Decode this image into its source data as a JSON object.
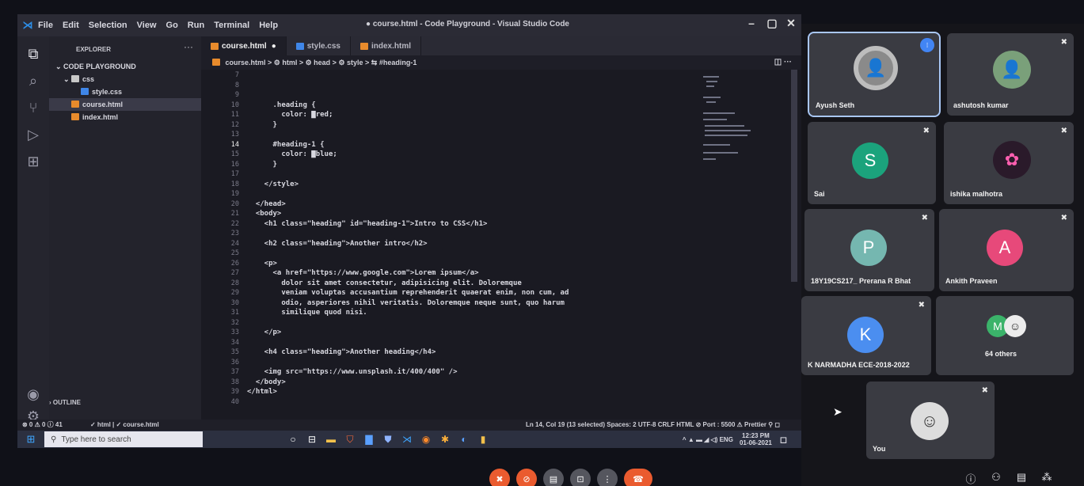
{
  "window": {
    "title": "● course.html - Code Playground - Visual Studio Code",
    "menu": [
      "File",
      "Edit",
      "Selection",
      "View",
      "Go",
      "Run",
      "Terminal",
      "Help"
    ],
    "controls": [
      "–",
      "▢",
      "✕"
    ]
  },
  "sidebar": {
    "header": "EXPLORER",
    "more": "···",
    "workspace": "CODE PLAYGROUND",
    "folder": "css",
    "files": [
      "style.css",
      "course.html",
      "index.html"
    ],
    "outline": "OUTLINE"
  },
  "tabs": [
    {
      "label": "course.html",
      "marker": "●",
      "type": "html"
    },
    {
      "label": "style.css",
      "marker": "",
      "type": "css"
    },
    {
      "label": "index.html",
      "marker": "",
      "type": "html"
    }
  ],
  "breadcrumb": "course.html > ⚙ html > ⚙ head > ⚙ style > ⇆ #heading-1",
  "breadcrumb_icons": "◫ ···",
  "editor": {
    "line_numbers": [
      "7",
      "8",
      "9",
      "10",
      "11",
      "12",
      "13",
      "14",
      "15",
      "16",
      "17",
      "18",
      "19",
      "20",
      "21",
      "22",
      "23",
      "24",
      "25",
      "26",
      "27",
      "28",
      "29",
      "30",
      "31",
      "32",
      "33",
      "34",
      "35",
      "36",
      "37",
      "38",
      "39",
      "40"
    ],
    "current_line": "14",
    "code": [
      "",
      "",
      "",
      "      .heading {",
      "        color: ▇red;",
      "      }",
      "",
      "      #heading-1 {",
      "        color: ▇blue;",
      "      }",
      "",
      "    </style>",
      "",
      "  </head>",
      "  <body>",
      "    <h1 class=\"heading\" id=\"heading-1\">Intro to CSS</h1>",
      "",
      "    <h2 class=\"heading\">Another intro</h2>",
      "",
      "    <p>",
      "      <a href=\"https://www.google.com\">Lorem ipsum</a>",
      "        dolor sit amet consectetur, adipisicing elit. Doloremque",
      "        veniam voluptas accusantium reprehenderit quaerat enim, non cum, ad",
      "        odio, asperiores nihil veritatis. Doloremque neque sunt, quo harum",
      "        similique quod nisi.",
      "",
      "    </p>",
      "",
      "    <h4 class=\"heading\">Another heading</h4>",
      "",
      "    <img src=\"https://www.unsplash.it/400/400\" />",
      "  </body>",
      "</html>",
      ""
    ]
  },
  "status": {
    "problems": "⊗ 0 ⚠ 0 ⓘ 41",
    "context": "✓ html | ✓ course.html",
    "right": "Ln 14, Col 19 (13 selected)   Spaces: 2   UTF-8   CRLF   HTML   ⊘ Port : 5500   ⚠ Prettier   ⚲   ◻"
  },
  "taskbar": {
    "search_placeholder": "Type here to search",
    "tray": "^ ▲ ▬ ◢ ◁) ENG",
    "time": "12:23 PM",
    "date": "01-06-2021"
  },
  "meet": {
    "participants": [
      {
        "name": "Ayush Seth",
        "initial": "",
        "color": "#8a8a8a",
        "active": true
      },
      {
        "name": "ashutosh kumar",
        "initial": "",
        "color": "#7aa07a",
        "active": false
      },
      {
        "name": "Sai",
        "initial": "S",
        "color": "#1ba37c",
        "active": false
      },
      {
        "name": "ishika malhotra",
        "initial": "",
        "color": "#2a1a2a",
        "active": false
      },
      {
        "name": "18Y19CS217_ Prerana R Bhat",
        "initial": "P",
        "color": "#75b7b0",
        "active": false
      },
      {
        "name": "Ankith Praveen",
        "initial": "A",
        "color": "#e7497a",
        "active": false
      },
      {
        "name": "K NARMADHA ECE-2018-2022",
        "initial": "K",
        "color": "#4b8ef0",
        "active": false
      },
      {
        "name": "64 others",
        "initial": "M",
        "color": "#3bb36a",
        "active": false
      },
      {
        "name": "You",
        "initial": "",
        "color": "#ddd",
        "active": false
      }
    ]
  }
}
